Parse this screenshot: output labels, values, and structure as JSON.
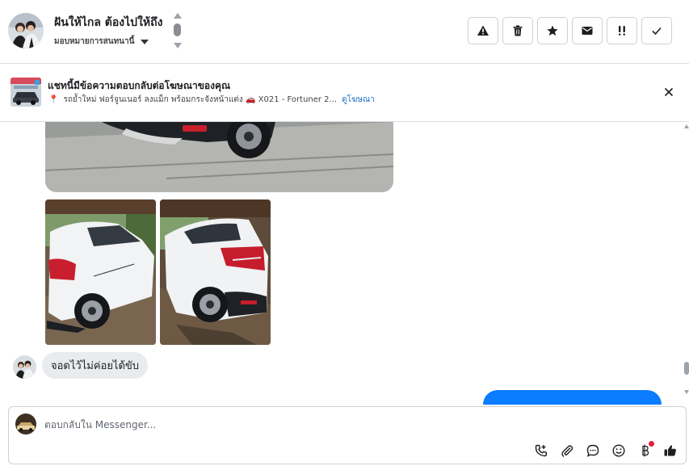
{
  "header": {
    "contact_name": "ฝันให้ไกล ต้องไปให้ถึง",
    "assign_label": "มอบหมายการสนทนานี้",
    "actions": [
      {
        "name": "report-spam-button",
        "icon": "warning-icon"
      },
      {
        "name": "delete-button",
        "icon": "trash-icon"
      },
      {
        "name": "star-button",
        "icon": "star-icon"
      },
      {
        "name": "mark-unread-button",
        "icon": "envelope-icon"
      },
      {
        "name": "follow-up-button",
        "icon": "exclamation-icon"
      },
      {
        "name": "mark-done-button",
        "icon": "check-icon"
      }
    ]
  },
  "ad_banner": {
    "title": "แชทนี้มีข้อความตอบกลับต่อโฆษณาของคุณ",
    "description": "รถย้ำใหม่ ฟอร์จูนเนอร์ ลงแม็ก พร้อมกระจังหน้าแต่ง 🚗 X021 - Fortuner 2...",
    "link": "ดูโฆษณา"
  },
  "messages": [
    {
      "type": "image",
      "from": "contact",
      "subject": "white Toyota Yaris rear wheel"
    },
    {
      "type": "image",
      "from": "contact",
      "subject": "white Toyota Yaris side view"
    },
    {
      "type": "image",
      "from": "contact",
      "subject": "white Toyota Yaris rear view"
    },
    {
      "type": "text",
      "from": "contact",
      "text": "จอดไว้ไม่ค่อยได้ขับ"
    },
    {
      "type": "text",
      "from": "page",
      "text": ""
    }
  ],
  "composer": {
    "placeholder": "ตอบกลับใน Messenger...",
    "tools": [
      "call-icon",
      "attachment-icon",
      "saved-reply-icon",
      "emoji-icon",
      "payment-icon",
      "like-icon"
    ]
  },
  "colors": {
    "accent": "#0a7cff",
    "link": "#1c6fc9",
    "notification": "#e41e3f",
    "bubble_in": "#e9ebee"
  }
}
